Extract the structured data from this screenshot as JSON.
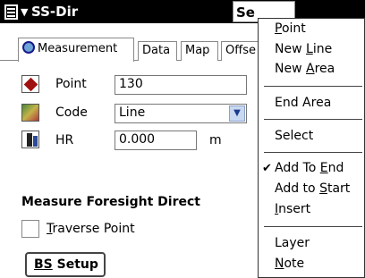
{
  "titlebar": {
    "title": "SS-Dir",
    "menu_button_label": "Se"
  },
  "tabs": [
    {
      "label": "Measurement",
      "active": true
    },
    {
      "label": "Data"
    },
    {
      "label": "Map"
    },
    {
      "label": "Offse"
    }
  ],
  "form": {
    "point": {
      "label": "Point",
      "value": "130"
    },
    "code": {
      "label": "Code",
      "value": "Line"
    },
    "hr": {
      "label": "HR",
      "value": "0.000",
      "unit": "m"
    },
    "section_label": "Measure Foresight Direct",
    "traverse_point": {
      "label_prefix": "T",
      "label_rest": "raverse Point",
      "checked": false
    },
    "bs_setup": {
      "label_prefix": "BS",
      "label_rest": " Setup"
    }
  },
  "menu": {
    "items": [
      {
        "pre": "",
        "key": "P",
        "post": "oint"
      },
      {
        "pre": "New ",
        "key": "L",
        "post": "ine"
      },
      {
        "pre": "New ",
        "key": "A",
        "post": "rea"
      },
      {
        "pre": "End Area",
        "key": "",
        "post": ""
      },
      {
        "pre": "Select",
        "key": "",
        "post": ""
      },
      {
        "pre": "Add To ",
        "key": "E",
        "post": "nd",
        "checked": true
      },
      {
        "pre": "Add to ",
        "key": "S",
        "post": "tart"
      },
      {
        "pre": "",
        "key": "I",
        "post": "nsert"
      },
      {
        "pre": "Layer",
        "key": "",
        "post": ""
      },
      {
        "pre": "",
        "key": "N",
        "post": "ote"
      }
    ],
    "check_glyph": "✔"
  },
  "icons": {
    "start": "start-menu-icon",
    "tab_measurement": "globe-icon",
    "point": "point-diamond-icon",
    "code": "code-icon",
    "hr": "instrument-height-icon",
    "select_arrow": "chevron-down-icon"
  }
}
